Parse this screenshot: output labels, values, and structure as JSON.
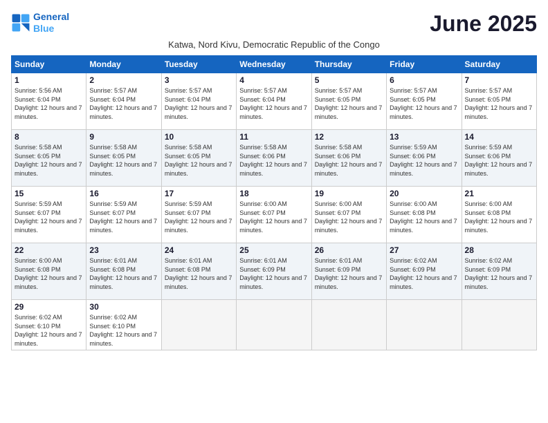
{
  "logo": {
    "line1": "General",
    "line2": "Blue"
  },
  "title": "June 2025",
  "subtitle": "Katwa, Nord Kivu, Democratic Republic of the Congo",
  "days_header": [
    "Sunday",
    "Monday",
    "Tuesday",
    "Wednesday",
    "Thursday",
    "Friday",
    "Saturday"
  ],
  "weeks": [
    [
      {
        "day": "1",
        "sunrise": "5:56 AM",
        "sunset": "6:04 PM",
        "daylight": "12 hours and 7 minutes."
      },
      {
        "day": "2",
        "sunrise": "5:57 AM",
        "sunset": "6:04 PM",
        "daylight": "12 hours and 7 minutes."
      },
      {
        "day": "3",
        "sunrise": "5:57 AM",
        "sunset": "6:04 PM",
        "daylight": "12 hours and 7 minutes."
      },
      {
        "day": "4",
        "sunrise": "5:57 AM",
        "sunset": "6:04 PM",
        "daylight": "12 hours and 7 minutes."
      },
      {
        "day": "5",
        "sunrise": "5:57 AM",
        "sunset": "6:05 PM",
        "daylight": "12 hours and 7 minutes."
      },
      {
        "day": "6",
        "sunrise": "5:57 AM",
        "sunset": "6:05 PM",
        "daylight": "12 hours and 7 minutes."
      },
      {
        "day": "7",
        "sunrise": "5:57 AM",
        "sunset": "6:05 PM",
        "daylight": "12 hours and 7 minutes."
      }
    ],
    [
      {
        "day": "8",
        "sunrise": "5:58 AM",
        "sunset": "6:05 PM",
        "daylight": "12 hours and 7 minutes."
      },
      {
        "day": "9",
        "sunrise": "5:58 AM",
        "sunset": "6:05 PM",
        "daylight": "12 hours and 7 minutes."
      },
      {
        "day": "10",
        "sunrise": "5:58 AM",
        "sunset": "6:05 PM",
        "daylight": "12 hours and 7 minutes."
      },
      {
        "day": "11",
        "sunrise": "5:58 AM",
        "sunset": "6:06 PM",
        "daylight": "12 hours and 7 minutes."
      },
      {
        "day": "12",
        "sunrise": "5:58 AM",
        "sunset": "6:06 PM",
        "daylight": "12 hours and 7 minutes."
      },
      {
        "day": "13",
        "sunrise": "5:59 AM",
        "sunset": "6:06 PM",
        "daylight": "12 hours and 7 minutes."
      },
      {
        "day": "14",
        "sunrise": "5:59 AM",
        "sunset": "6:06 PM",
        "daylight": "12 hours and 7 minutes."
      }
    ],
    [
      {
        "day": "15",
        "sunrise": "5:59 AM",
        "sunset": "6:07 PM",
        "daylight": "12 hours and 7 minutes."
      },
      {
        "day": "16",
        "sunrise": "5:59 AM",
        "sunset": "6:07 PM",
        "daylight": "12 hours and 7 minutes."
      },
      {
        "day": "17",
        "sunrise": "5:59 AM",
        "sunset": "6:07 PM",
        "daylight": "12 hours and 7 minutes."
      },
      {
        "day": "18",
        "sunrise": "6:00 AM",
        "sunset": "6:07 PM",
        "daylight": "12 hours and 7 minutes."
      },
      {
        "day": "19",
        "sunrise": "6:00 AM",
        "sunset": "6:07 PM",
        "daylight": "12 hours and 7 minutes."
      },
      {
        "day": "20",
        "sunrise": "6:00 AM",
        "sunset": "6:08 PM",
        "daylight": "12 hours and 7 minutes."
      },
      {
        "day": "21",
        "sunrise": "6:00 AM",
        "sunset": "6:08 PM",
        "daylight": "12 hours and 7 minutes."
      }
    ],
    [
      {
        "day": "22",
        "sunrise": "6:00 AM",
        "sunset": "6:08 PM",
        "daylight": "12 hours and 7 minutes."
      },
      {
        "day": "23",
        "sunrise": "6:01 AM",
        "sunset": "6:08 PM",
        "daylight": "12 hours and 7 minutes."
      },
      {
        "day": "24",
        "sunrise": "6:01 AM",
        "sunset": "6:08 PM",
        "daylight": "12 hours and 7 minutes."
      },
      {
        "day": "25",
        "sunrise": "6:01 AM",
        "sunset": "6:09 PM",
        "daylight": "12 hours and 7 minutes."
      },
      {
        "day": "26",
        "sunrise": "6:01 AM",
        "sunset": "6:09 PM",
        "daylight": "12 hours and 7 minutes."
      },
      {
        "day": "27",
        "sunrise": "6:02 AM",
        "sunset": "6:09 PM",
        "daylight": "12 hours and 7 minutes."
      },
      {
        "day": "28",
        "sunrise": "6:02 AM",
        "sunset": "6:09 PM",
        "daylight": "12 hours and 7 minutes."
      }
    ],
    [
      {
        "day": "29",
        "sunrise": "6:02 AM",
        "sunset": "6:10 PM",
        "daylight": "12 hours and 7 minutes."
      },
      {
        "day": "30",
        "sunrise": "6:02 AM",
        "sunset": "6:10 PM",
        "daylight": "12 hours and 7 minutes."
      },
      null,
      null,
      null,
      null,
      null
    ]
  ]
}
